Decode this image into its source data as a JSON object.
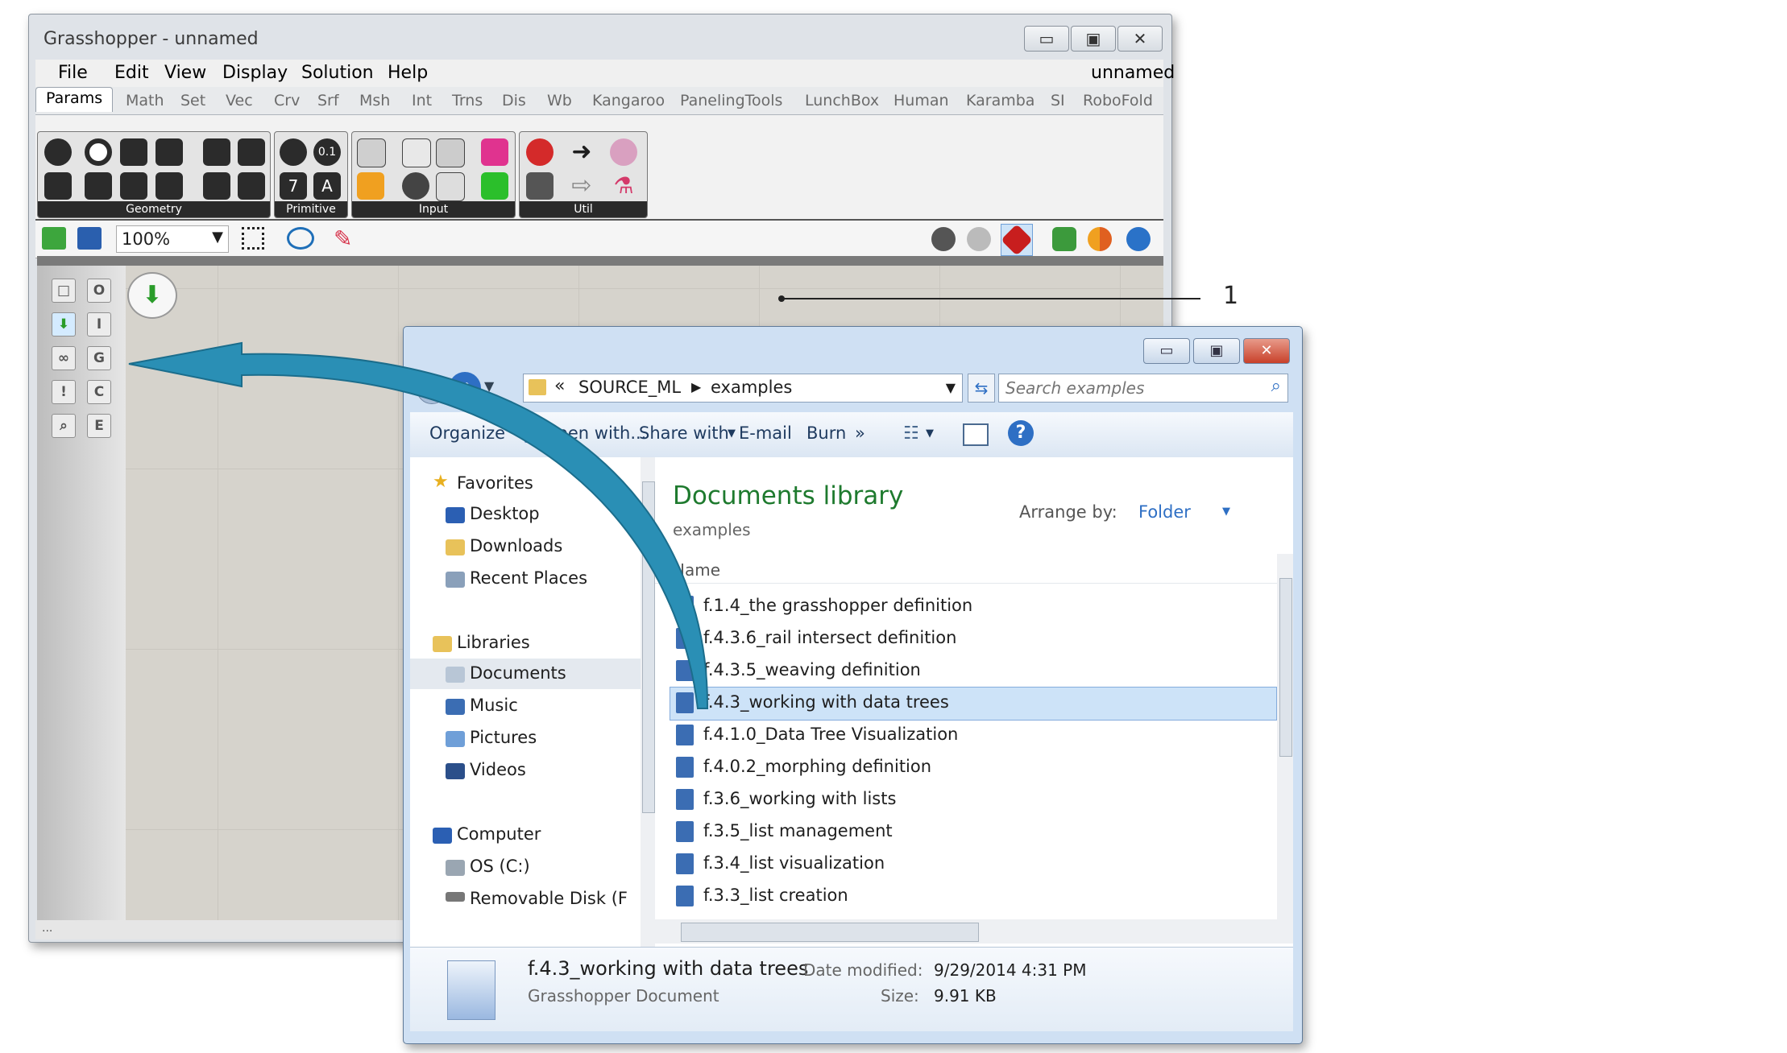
{
  "gh": {
    "title": "Grasshopper - unnamed",
    "doc_name": "unnamed",
    "window_buttons": {
      "minimize": "▭",
      "maximize": "▣",
      "close": "✕"
    },
    "menu": [
      "File",
      "Edit",
      "View",
      "Display",
      "Solution",
      "Help"
    ],
    "tabs": [
      "Params",
      "Math",
      "Set",
      "Vec",
      "Crv",
      "Srf",
      "Msh",
      "Int",
      "Trns",
      "Dis",
      "Wb",
      "Kangaroo",
      "PanelingTools",
      "LunchBox",
      "Human",
      "Karamba",
      "SI",
      "RoboFold"
    ],
    "groups": [
      "Geometry",
      "Primitive",
      "Input",
      "Util"
    ],
    "primitive_labels": [
      "0.1",
      "7",
      "A"
    ],
    "zoom": "100%",
    "side_letters": [
      "O",
      "I",
      "G",
      "C",
      "E"
    ],
    "status": "..."
  },
  "callout": "1",
  "explorer": {
    "breadcrumb_prefix": "«",
    "path": [
      "SOURCE_ML",
      "examples"
    ],
    "search_placeholder": "Search examples",
    "commands": [
      "Organize",
      "Open with...",
      "Share with",
      "E-mail",
      "Burn",
      "»"
    ],
    "nav": {
      "favorites": "Favorites",
      "favorites_items": [
        "Desktop",
        "Downloads",
        "Recent Places"
      ],
      "libraries": "Libraries",
      "libraries_items": [
        "Documents",
        "Music",
        "Pictures",
        "Videos"
      ],
      "computer": "Computer",
      "computer_items": [
        "OS (C:)",
        "Removable Disk (F"
      ]
    },
    "library_title": "Documents library",
    "library_sub": "examples",
    "arrange_label": "Arrange by:",
    "arrange_value": "Folder",
    "column_name": "Name",
    "files": [
      "f.1.4_the grasshopper definition",
      "f.4.3.6_rail intersect definition",
      "f.4.3.5_weaving definition",
      "f.4.3_working with data trees",
      "f.4.1.0_Data Tree Visualization",
      "f.4.0.2_morphing definition",
      "f.3.6_working with lists",
      "f.3.5_list management",
      "f.3.4_list visualization",
      "f.3.3_list creation"
    ],
    "selected_file": "f.4.3_working with data trees",
    "details": {
      "name": "f.4.3_working with data trees",
      "type": "Grasshopper Document",
      "modified_label": "Date modified:",
      "modified_value": "9/29/2014 4:31 PM",
      "size_label": "Size:",
      "size_value": "9.91 KB"
    }
  },
  "colors": {
    "accent_arrow": "#2a8fb5",
    "selection": "#cde3f8",
    "library_title": "#1e7a2e"
  }
}
